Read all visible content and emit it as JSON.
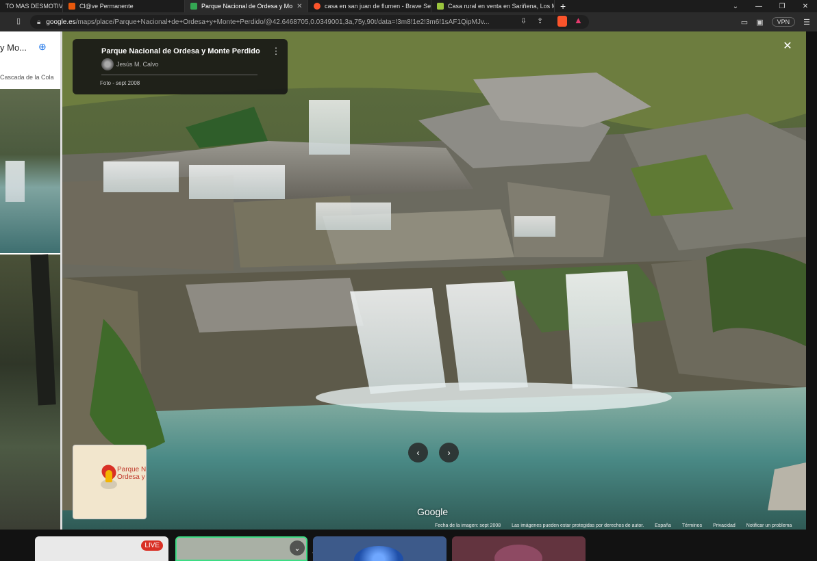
{
  "tabs": [
    {
      "label": "TO MAS DESMOTIVAN",
      "active": false,
      "favicon_color": "#555555"
    },
    {
      "label": "Cl@ve Permanente",
      "active": false,
      "favicon_color": "#e8580c"
    },
    {
      "label": "Parque Nacional de Ordesa y Mo",
      "active": true,
      "favicon_color": "#34a853"
    },
    {
      "label": "casa en san juan de flumen - Brave Se",
      "active": false,
      "favicon_color": "#fb542b"
    },
    {
      "label": "Casa rural en venta en Sariñena, Los M",
      "active": false,
      "favicon_color": "#9bc53d"
    }
  ],
  "address": {
    "host": "google.es",
    "path": "/maps/place/Parque+Nacional+de+Ordesa+y+Monte+Perdido/@42.6468705,0.0349001,3a,75y,90t/data=!3m8!1e2!3m6!1sAF1QipMJv..."
  },
  "vpn_label": "VPN",
  "left_panel": {
    "title": "y Mo...",
    "subtitle": "Cascada de la Cola"
  },
  "info_card": {
    "title": "Parque Nacional de Ordesa y Monte Perdido",
    "author": "Jesús M. Calvo",
    "date": "Foto - sept 2008"
  },
  "minimap": {
    "label_line1": "Parque N",
    "label_line2": "Ordesa y"
  },
  "google_logo": "Google",
  "footer": {
    "date": "Fecha de la imagen: sept 2008",
    "rights": "Las imágenes pueden estar protegidas por derechos de autor.",
    "country": "España",
    "terms": "Términos",
    "privacy": "Privacidad",
    "report": "Notificar un problema"
  },
  "bottom": {
    "live_badge": "LIVE"
  },
  "colors": {
    "accent": "#1a73e8",
    "live": "#d93025",
    "active_speaker": "#3ddc84"
  }
}
